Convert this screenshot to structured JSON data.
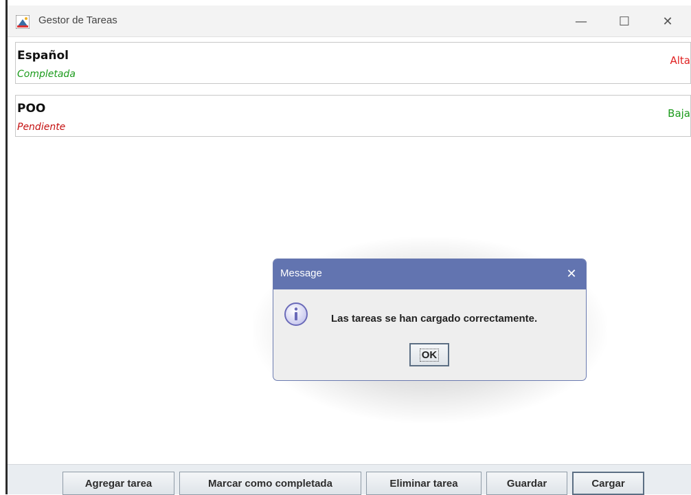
{
  "window": {
    "title": "Gestor de Tareas",
    "controls": {
      "minimize": "—",
      "maximize": "☐",
      "close": "✕"
    }
  },
  "tasks": [
    {
      "name": "Español",
      "status": "Completada",
      "status_color": "#1a9a1a",
      "priority": "Alta",
      "priority_color": "#e02020"
    },
    {
      "name": "POO",
      "status": "Pendiente",
      "status_color": "#c41010",
      "priority": "Baja",
      "priority_color": "#1a9a1a"
    }
  ],
  "toolbar": {
    "add_label": "Agregar tarea",
    "complete_label": "Marcar como completada",
    "delete_label": "Eliminar tarea",
    "save_label": "Guardar",
    "load_label": "Cargar"
  },
  "dialog": {
    "title": "Message",
    "close": "✕",
    "icon": "info-icon",
    "message": "Las tareas se han cargado correctamente.",
    "ok_label": "OK"
  },
  "colors": {
    "dialog_titlebar": "#6274b0",
    "footer_bg": "#e9edf1"
  }
}
